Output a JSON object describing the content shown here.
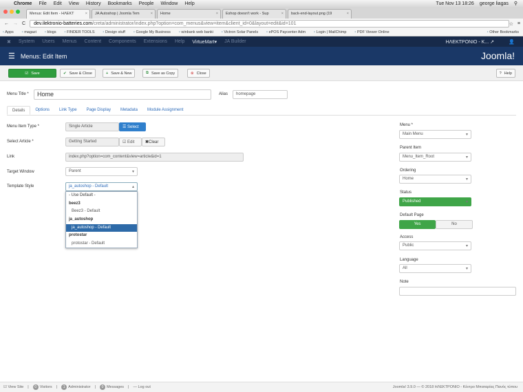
{
  "macbar": {
    "app": "Chrome",
    "menus": [
      "File",
      "Edit",
      "View",
      "History",
      "Bookmarks",
      "People",
      "Window",
      "Help"
    ],
    "datetime": "Tue Nov 13  18:26",
    "user": "george liagas"
  },
  "browser": {
    "tabs": [
      "Menus: Edit Item - ΗΛΕΚΤ",
      "JA Autoshop | Joomla Tem",
      "Home",
      "Eshop doesn't work - Sup",
      "back-end-layout.png (19"
    ],
    "url_host": "dev.ilektronio-batteries.com",
    "url_path": "/creta/administrator/index.php?option=com_menus&view=item&client_id=0&layout=edit&id=101",
    "bookmarks": [
      "Apps",
      "magazi",
      "blogs",
      "FINDER TOOLS",
      "Design stuff",
      "Google My Business",
      "winbank web banki",
      "Victron Solar Panels",
      "ePOS Paycenter Adm",
      "Login | MailChimp",
      "PDF Viewer Online"
    ],
    "other_bookmarks": "Other Bookmarks"
  },
  "nav": {
    "items": [
      "System",
      "Users",
      "Menus",
      "Content",
      "Components",
      "Extensions",
      "Help",
      "VirtueMart▾",
      "JA Builder"
    ],
    "site": "ΗΛΕΚΤΡΟΝΙΟ - K... ↗",
    "user_icon": "👤"
  },
  "header": {
    "title": "Menus: Edit Item",
    "logo": "Joomla!"
  },
  "toolbar": {
    "save": "Save",
    "save_close": "Save & Close",
    "save_new": "Save & New",
    "save_copy": "Save as Copy",
    "close": "Close",
    "help": "Help"
  },
  "form": {
    "title_label": "Menu Title *",
    "title_value": "Home",
    "alias_label": "Alias",
    "alias_value": "homepage",
    "tabs": [
      "Details",
      "Options",
      "Link Type",
      "Page Display",
      "Metadata",
      "Module Assignment"
    ],
    "type_label": "Menu Item Type *",
    "type_value": "Single Article",
    "select_btn": "Select",
    "article_label": "Select Article *",
    "article_value": "Getting Started",
    "edit_btn": "Edit",
    "clear_btn": "Clear",
    "link_label": "Link",
    "link_value": "index.php?option=com_content&view=article&id=1",
    "target_label": "Target Window",
    "target_value": "Parent",
    "template_label": "Template Style",
    "template_value": "ja_autoshop - Default",
    "template_options": [
      {
        "t": "- Use Default -",
        "k": "o0"
      },
      {
        "t": "beez3",
        "k": "g"
      },
      {
        "t": "Beez3 - Default",
        "k": "o"
      },
      {
        "t": "ja_autoshop",
        "k": "g"
      },
      {
        "t": "ja_autoshop - Default",
        "k": "s"
      },
      {
        "t": "protostar",
        "k": "g"
      },
      {
        "t": "protostar - Default",
        "k": "o"
      }
    ]
  },
  "side": {
    "menu_label": "Menu *",
    "menu_value": "Main Menu",
    "parent_label": "Parent Item",
    "parent_value": "Menu_Item_Root",
    "ordering_label": "Ordering",
    "ordering_value": "Home",
    "status_label": "Status",
    "status_value": "Published",
    "default_label": "Default Page",
    "yes": "Yes",
    "no": "No",
    "access_label": "Access",
    "access_value": "Public",
    "language_label": "Language",
    "language_value": "All",
    "note_label": "Note"
  },
  "footer": {
    "view_site": "View Site",
    "visitors_count": "0",
    "visitors": "Visitors",
    "admin_count": "1",
    "admin": "Administrator",
    "messages_count": "0",
    "messages": "Messages",
    "logout": "Log out",
    "copyright": "Joomla! 3.9.0  —  © 2018 ΗΛΕΚΤΡΟΝΙΟ - Κέντρο Μπαταρίας Πανός τύπου"
  }
}
